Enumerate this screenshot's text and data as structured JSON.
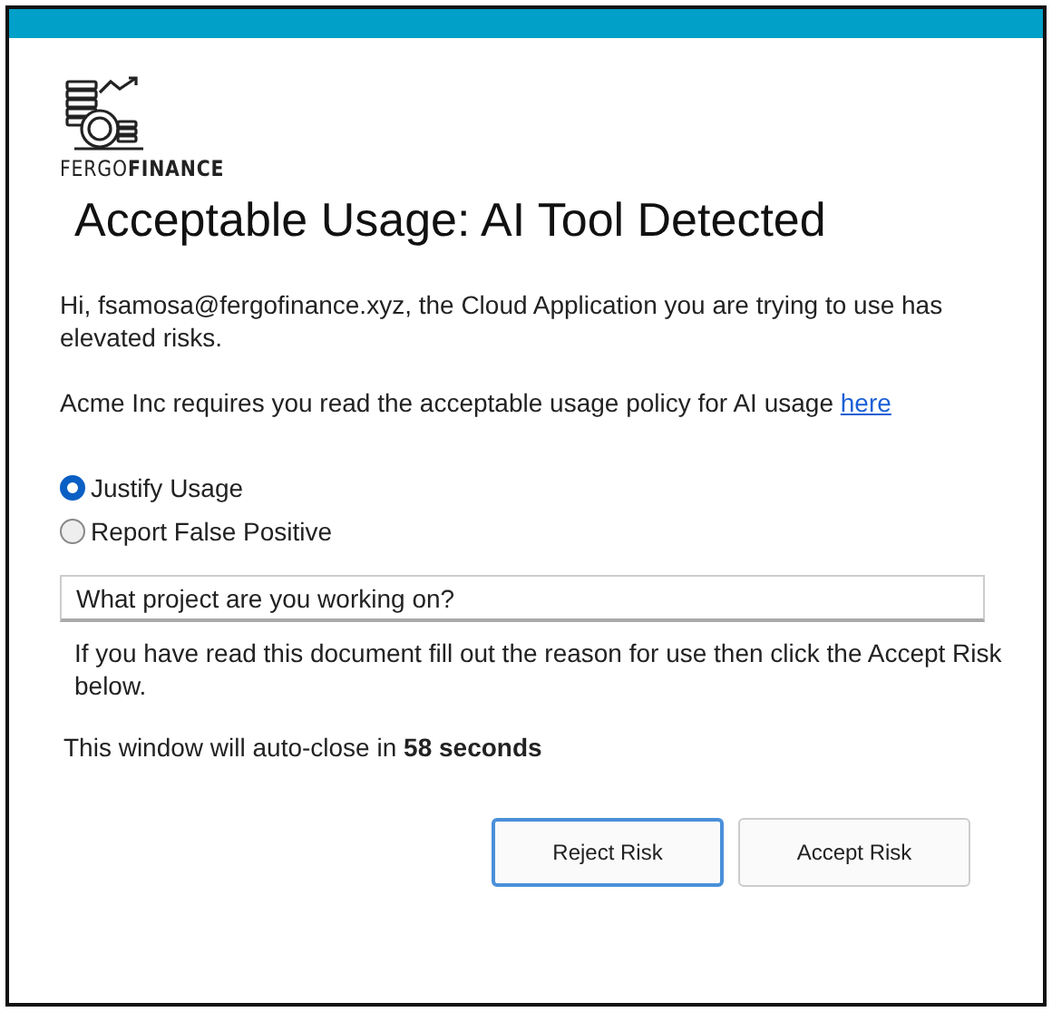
{
  "logo": {
    "wordmark": "FERGO**FINANCE**"
  },
  "title": "Acceptable Usage: AI Tool Detected",
  "greeting": "Hi, fsamosa@fergofinance.xyz, the Cloud Application you are trying to use has elevated risks.",
  "policy": {
    "text": "Acme Inc requires you read the acceptable usage policy for AI usage",
    "link": "here"
  },
  "options": [
    {
      "label": "Justify Usage",
      "selected": true
    },
    {
      "label": "Report False Positive",
      "selected": false
    }
  ],
  "reason_field": {
    "placeholder": "What project are you working on?"
  },
  "instructions": "If you have read this document fill out the reason for use then click the Accept Risk below.",
  "countdown": "This window will auto-close in **58 seconds**",
  "buttons": [
    {
      "label": "Reject Risk",
      "focused": true
    },
    {
      "label": "Accept Risk",
      "focused": false
    }
  ]
}
